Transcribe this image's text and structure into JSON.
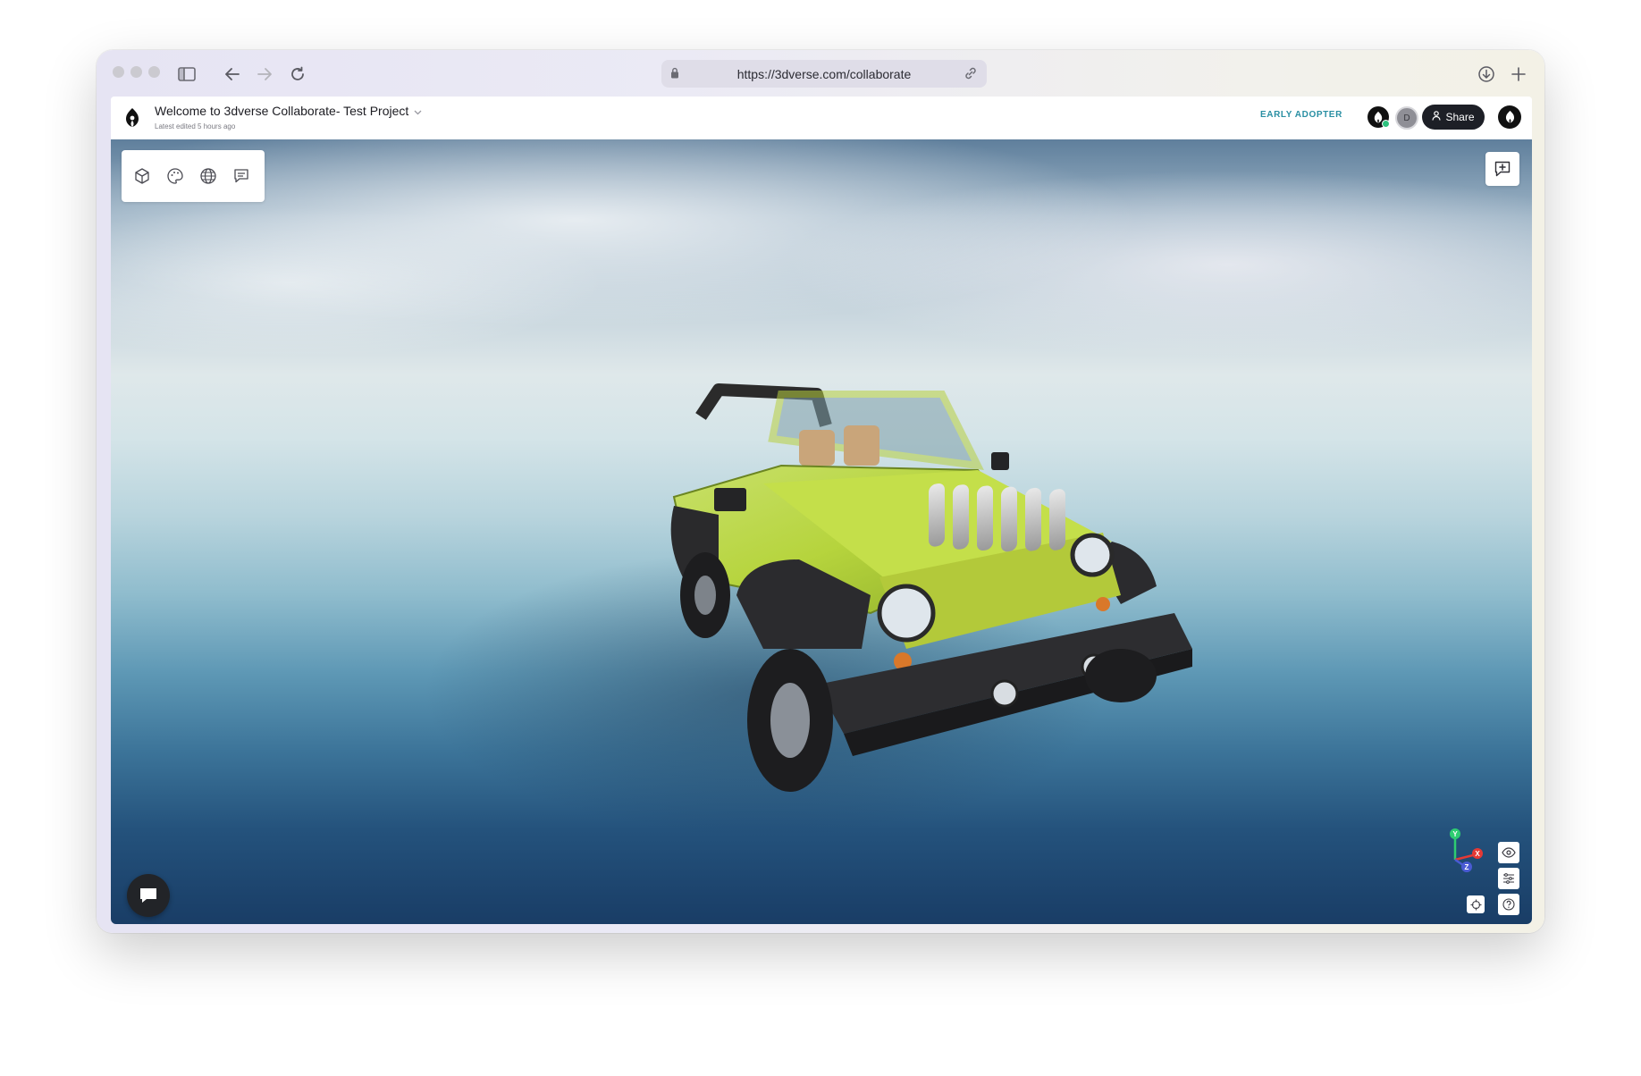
{
  "browser": {
    "url": "https://3dverse.com/collaborate"
  },
  "app": {
    "project_title": "Welcome to 3dverse Collaborate- Test Project",
    "project_subtitle": "Latest edited 5 hours ago",
    "early_adopter_label": "EARLY ADOPTER",
    "collaborator_initial": "D",
    "share_label": "Share"
  },
  "toolbar": {
    "tools": [
      "cube-icon",
      "palette-icon",
      "globe-icon",
      "comment-icon"
    ]
  },
  "viewport": {
    "gizmo_axes": [
      "Y",
      "X",
      "Z"
    ],
    "colors": {
      "x": "#e53935",
      "y": "#2ecc71",
      "z": "#4a5bd4"
    }
  }
}
